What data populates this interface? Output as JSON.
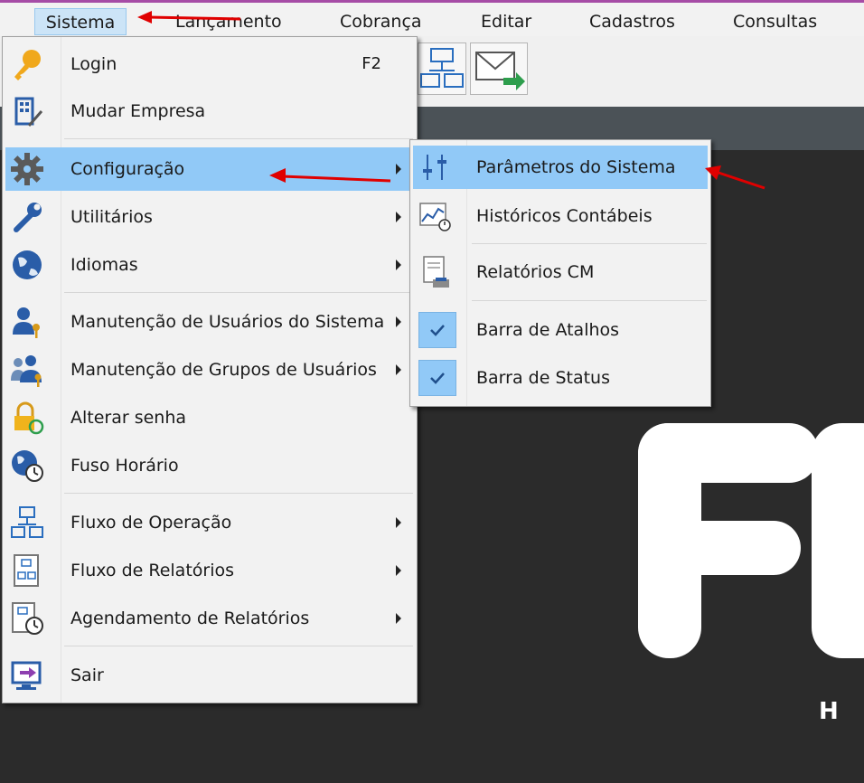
{
  "menubar": {
    "items": [
      {
        "label": "Sistema",
        "selected": true
      },
      {
        "label": "Lançamento"
      },
      {
        "label": "Cobrança"
      },
      {
        "label": "Editar"
      },
      {
        "label": "Cadastros"
      },
      {
        "label": "Consultas"
      }
    ]
  },
  "system_menu": {
    "items": [
      {
        "label": "Login",
        "shortcut": "F2",
        "icon": "key-icon"
      },
      {
        "label": "Mudar Empresa",
        "icon": "building-pencil-icon"
      },
      {
        "label": "Configuração",
        "icon": "gear-icon",
        "submenu": true,
        "highlighted": true
      },
      {
        "label": "Utilitários",
        "icon": "wrench-icon",
        "submenu": true
      },
      {
        "label": "Idiomas",
        "icon": "globe-icon",
        "submenu": true
      },
      {
        "label": "Manutenção de Usuários do Sistema",
        "icon": "user-key-icon",
        "submenu": true
      },
      {
        "label": "Manutenção de Grupos de Usuários",
        "icon": "users-key-icon",
        "submenu": true
      },
      {
        "label": "Alterar senha",
        "icon": "lock-refresh-icon"
      },
      {
        "label": "Fuso Horário",
        "icon": "globe-clock-icon"
      },
      {
        "label": "Fluxo de Operação",
        "icon": "flowchart-icon",
        "submenu": true
      },
      {
        "label": "Fluxo de Relatórios",
        "icon": "report-flow-icon",
        "submenu": true
      },
      {
        "label": "Agendamento de Relatórios",
        "icon": "report-clock-icon",
        "submenu": true
      },
      {
        "label": "Sair",
        "icon": "exit-monitor-icon"
      }
    ]
  },
  "config_submenu": {
    "items": [
      {
        "label": "Parâmetros do Sistema",
        "icon": "sliders-icon",
        "highlighted": true
      },
      {
        "label": "Históricos Contábeis",
        "icon": "chart-clock-icon"
      },
      {
        "label": "Relatórios CM",
        "icon": "document-printer-icon"
      },
      {
        "label": "Barra de Atalhos",
        "checked": true
      },
      {
        "label": "Barra de Status",
        "checked": true
      }
    ]
  },
  "logo": {
    "letter": "H"
  },
  "colors": {
    "highlight": "#91c9f7",
    "annotation_arrow": "#e00000",
    "menu_bg": "#f2f2f2"
  }
}
